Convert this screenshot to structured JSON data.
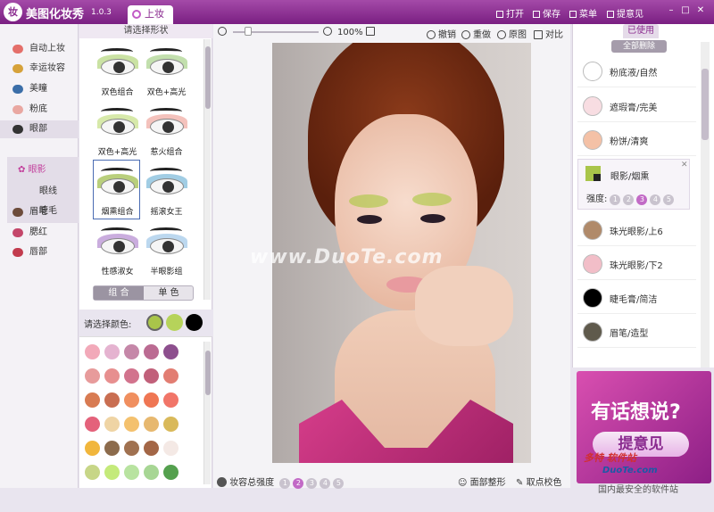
{
  "app": {
    "title": "美图化妆秀",
    "version": "1.0.3",
    "logo_glyph": "妆",
    "tab": "上妆"
  },
  "titlebar_menu": [
    "打开",
    "保存",
    "菜单",
    "提意见"
  ],
  "leftnav": {
    "items": [
      {
        "label": "自动上妆",
        "color": "#e46f6a"
      },
      {
        "label": "幸运妆容",
        "color": "#d6a23a"
      },
      {
        "label": "美瞳",
        "color": "#3b6ea8"
      },
      {
        "label": "粉底",
        "color": "#e9a7a1"
      },
      {
        "label": "眼部",
        "color": "#333333"
      },
      {
        "label": "眉毛",
        "color": "#6d4c3b"
      },
      {
        "label": "腮红",
        "color": "#c4476a"
      },
      {
        "label": "唇部",
        "color": "#c23c4e"
      }
    ],
    "sub": [
      "眼影",
      "眼线",
      "睫毛"
    ]
  },
  "shape_panel": {
    "header": "请选择形状",
    "items": [
      {
        "label": "双色组合",
        "lid": "#b4d67c"
      },
      {
        "label": "双色+高光",
        "lid": "#a8d28a"
      },
      {
        "label": "双色+高光",
        "lid": "#c6df86"
      },
      {
        "label": "惹火组合",
        "lid": "#f0a8a0"
      },
      {
        "label": "烟熏组合",
        "lid": "#9bbb44"
      },
      {
        "label": "摇滚女王",
        "lid": "#79b8d8"
      },
      {
        "label": "性感淑女",
        "lid": "#b48ad0"
      },
      {
        "label": "半眼影组",
        "lid": "#9fc8e8"
      }
    ],
    "toggle": [
      "组 合",
      "单 色"
    ]
  },
  "color_select": {
    "label": "请选择颜色:",
    "chips": [
      "#a9c54a",
      "#b6d35a",
      "#000000"
    ]
  },
  "swatches": [
    "#f2a9b9",
    "#e5b3d0",
    "#c587a8",
    "#bb6b92",
    "#8d4f8e",
    "#e79b9b",
    "#e78f8f",
    "#d2738d",
    "#c1607a",
    "#e27d72",
    "#d87b52",
    "#c96e51",
    "#f08f5f",
    "#ef7653",
    "#f17568",
    "#e4627b",
    "#efd4a4",
    "#f4c16e",
    "#e7b86f",
    "#d9b95a",
    "#f1b63c",
    "#8c6b4c",
    "#a07150",
    "#a36646",
    "#f4e9e5",
    "#c7d687",
    "#c4ea7a",
    "#b8e3a0",
    "#a7d694",
    "#54a04e"
  ],
  "toolbar": {
    "zoom": "100%",
    "undo": "撤销",
    "redo": "重做",
    "original": "原图",
    "compare": "对比"
  },
  "canvas": {
    "watermark": "www.DuoTe.com"
  },
  "bottom": {
    "strength_label": "妆容总强度",
    "steps": [
      "1",
      "2",
      "3",
      "4",
      "5"
    ],
    "face_shape": "面部整形",
    "keypoint": "取点校色"
  },
  "right_panel": {
    "tab": "已使用",
    "delete_all": "全部删除",
    "items": [
      {
        "label": "粉底液/自然",
        "color": "#ffffff"
      },
      {
        "label": "遮瑕膏/完美",
        "color": "#f8dde2"
      },
      {
        "label": "粉饼/清爽",
        "color": "#f4c1a6"
      },
      {
        "label": "珠光眼影/上6",
        "color": "#b08a6a"
      },
      {
        "label": "珠光眼影/下2",
        "color": "#f2bec8"
      },
      {
        "label": "睫毛膏/简洁",
        "color": "#000000"
      },
      {
        "label": "眉笔/造型",
        "color": "#5f5a4c"
      }
    ],
    "selected": {
      "label": "眼影/烟熏",
      "strength_label": "强度:",
      "steps": [
        "1",
        "2",
        "3",
        "4",
        "5"
      ],
      "active": 3,
      "color1": "#a9c54a",
      "color2": "#222222"
    }
  },
  "promo": {
    "title": "有话想说?",
    "button": "提意见"
  },
  "corner_mark": {
    "brand": "多特 软件站",
    "site": "DuoTe.com",
    "tagline": "国内最安全的软件站"
  }
}
